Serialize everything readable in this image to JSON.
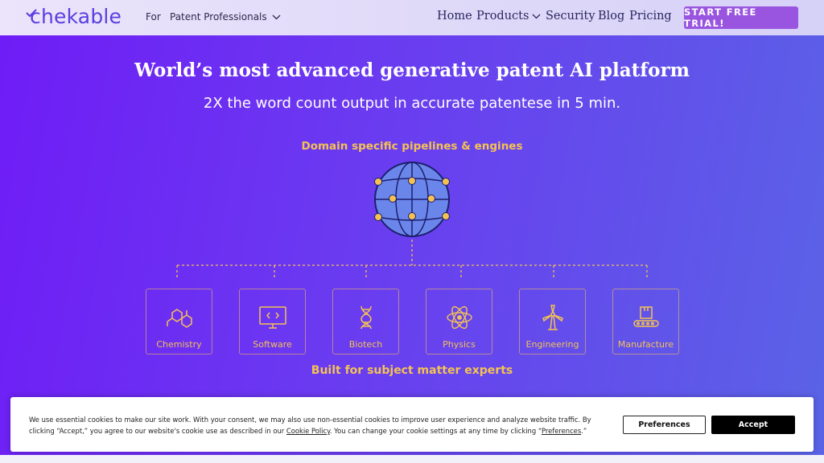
{
  "nav": {
    "logo": "chekable",
    "for_label": "For",
    "audience": "Patent Professionals",
    "links": [
      "Home",
      "Products",
      "Security",
      "Blog",
      "Pricing"
    ],
    "cta": "START FREE TRIAL!"
  },
  "hero": {
    "headline": "World’s most advanced generative patent AI platform",
    "subline": "2X the word count output in accurate patentese in 5 min.",
    "pipelines_label": "Domain specific pipelines & engines",
    "experts_label": "Built for subject matter experts"
  },
  "domains": [
    {
      "label": "Chemistry",
      "icon": "molecule-icon"
    },
    {
      "label": "Software",
      "icon": "monitor-code-icon"
    },
    {
      "label": "Biotech",
      "icon": "dna-icon"
    },
    {
      "label": "Physics",
      "icon": "atom-icon"
    },
    {
      "label": "Engineering",
      "icon": "wind-turbine-icon"
    },
    {
      "label": "Manufacture",
      "icon": "conveyor-box-icon"
    }
  ],
  "cookie": {
    "text_1": "We use essential cookies to make our site work. With your consent, we may also use non-essential cookies to improve user experience and analyze website traffic. By clicking “Accept,” you agree to our website's cookie use as described in our ",
    "policy_link": "Cookie Policy",
    "text_2": ". You can change your cookie settings at any time by clicking “",
    "pref_link": "Preferences",
    "text_3": ".”",
    "preferences_button": "Preferences",
    "accept_button": "Accept"
  },
  "colors": {
    "accent": "#f4c253",
    "cta": "#9a55e0",
    "brand": "#5a3fe0"
  }
}
